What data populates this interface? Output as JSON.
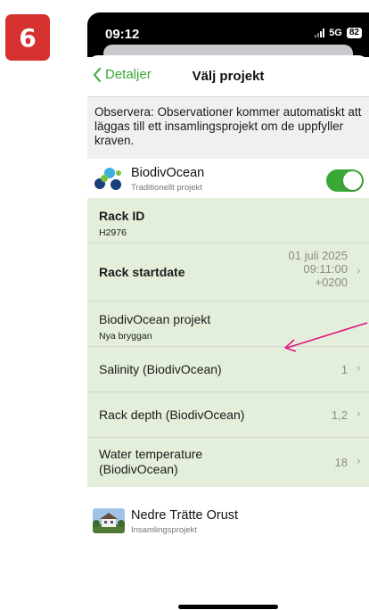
{
  "step_badge": "6",
  "status_bar": {
    "time": "09:12",
    "network": "5G",
    "battery": "82"
  },
  "nav": {
    "back_label": "Detaljer",
    "title": "Välj projekt"
  },
  "notice": "Observera: Observationer kommer automatiskt att läggas till ett insamlingsprojekt om de uppfyller kraven.",
  "project": {
    "name": "BiodivOcean",
    "type": "Traditionellt projekt",
    "enabled": true
  },
  "fields": {
    "rack_id": {
      "label": "Rack ID",
      "value": "H2976"
    },
    "rack_startdate": {
      "label": "Rack startdate",
      "value_line1": "01 juli 2025",
      "value_line2": "09:11:00",
      "value_line3": "+0200"
    },
    "biodiv_project": {
      "label": "BiodivOcean projekt",
      "value": "Nya bryggan"
    },
    "salinity": {
      "label": "Salinity (BiodivOcean)",
      "value": "1"
    },
    "rack_depth": {
      "label": "Rack depth (BiodivOcean)",
      "value": "1,2"
    },
    "water_temp": {
      "label_line1": "Water temperature",
      "label_line2": "(BiodivOcean)",
      "value": "18"
    }
  },
  "second_project": {
    "name": "Nedre Trätte Orust",
    "type": "Insamlingsprojekt"
  },
  "colors": {
    "accent_green": "#3aa836",
    "panel_green": "#e4efdb",
    "badge_red": "#d5312f",
    "arrow_magenta": "#e0147e"
  },
  "icons": [
    "chevron-left-icon",
    "signal-icon",
    "battery-icon",
    "chevron-right-icon",
    "arrow-icon"
  ]
}
